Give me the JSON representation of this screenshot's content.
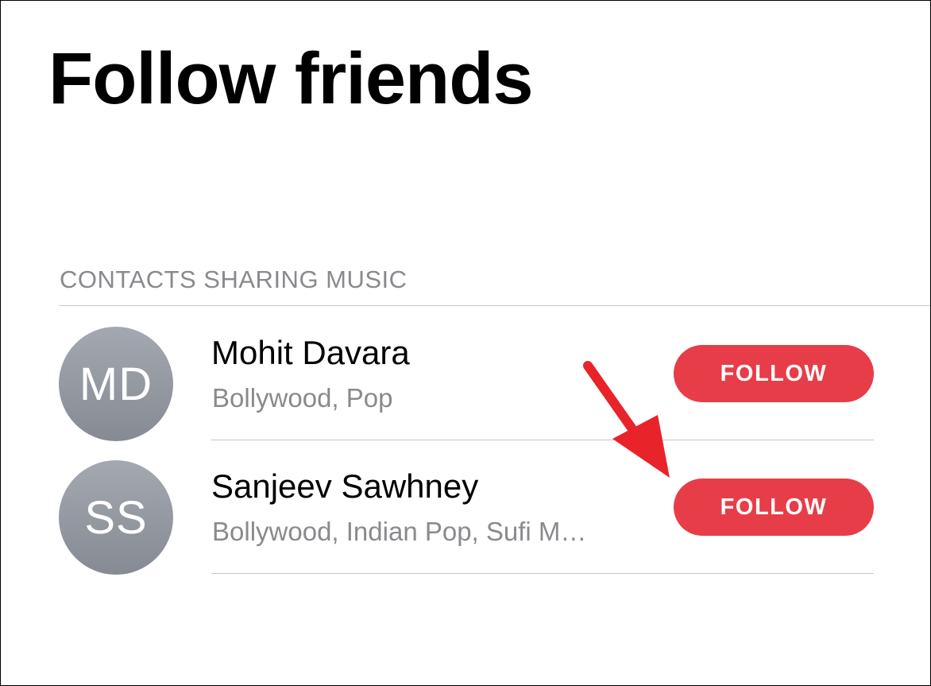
{
  "page": {
    "title": "Follow friends"
  },
  "section": {
    "header": "CONTACTS SHARING MUSIC"
  },
  "contacts": [
    {
      "initials": "MD",
      "name": "Mohit Davara",
      "genres": "Bollywood, Pop",
      "button_label": "FOLLOW"
    },
    {
      "initials": "SS",
      "name": "Sanjeev Sawhney",
      "genres": "Bollywood, Indian Pop, Sufi M…",
      "button_label": "FOLLOW"
    }
  ],
  "colors": {
    "accent": "#e73d48",
    "secondary_text": "#8a8a8e",
    "divider": "#c8c8cc",
    "annotation_arrow": "#e8232a"
  },
  "icons": {
    "annotation": "red-arrow-icon"
  }
}
